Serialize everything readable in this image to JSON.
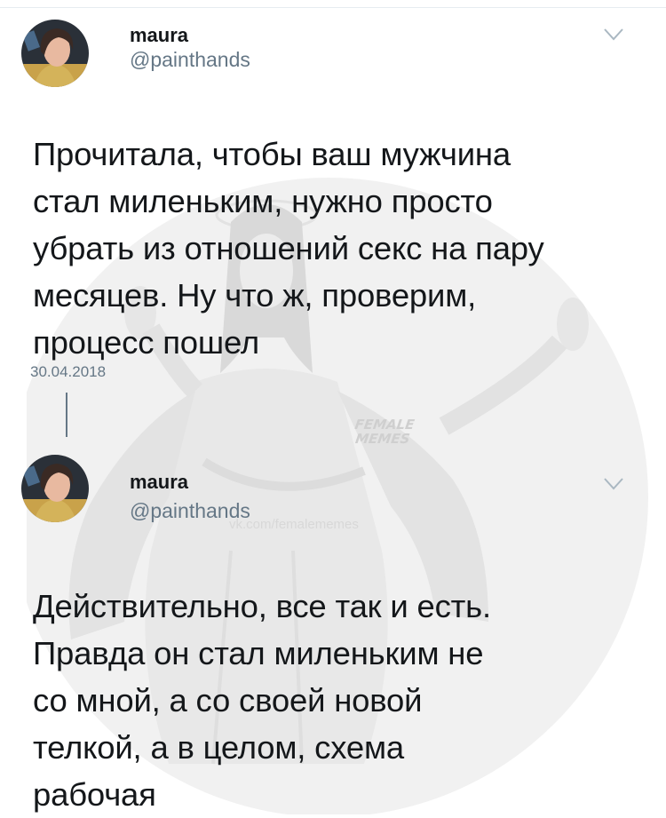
{
  "tweet1": {
    "name": "maura",
    "handle": "@painthands",
    "text_lines": [
      "Прочитала, чтобы ваш мужчина",
      "стал миленьким, нужно просто",
      "убрать из отношений секс на пару",
      "месяцев. Ну что ж, проверим,",
      "процесс пошел"
    ],
    "date": "30.04.2018"
  },
  "tweet2": {
    "name": "maura",
    "handle": "@painthands",
    "text_lines": [
      "Действительно, все так и есть.",
      "Правда он стал миленьким не",
      "со мной, а со своей новой",
      "телкой, а в целом, схема",
      "рабочая"
    ]
  },
  "watermark": {
    "brand_line1": "FEMALE",
    "brand_line2": "MEMES",
    "url": "vk.com/femalememes"
  },
  "colors": {
    "text": "#14171a",
    "secondary": "#657786",
    "divider": "#e6ecf0"
  },
  "icons": {
    "menu": "chevron-down-icon",
    "avatar": "user-photo"
  }
}
